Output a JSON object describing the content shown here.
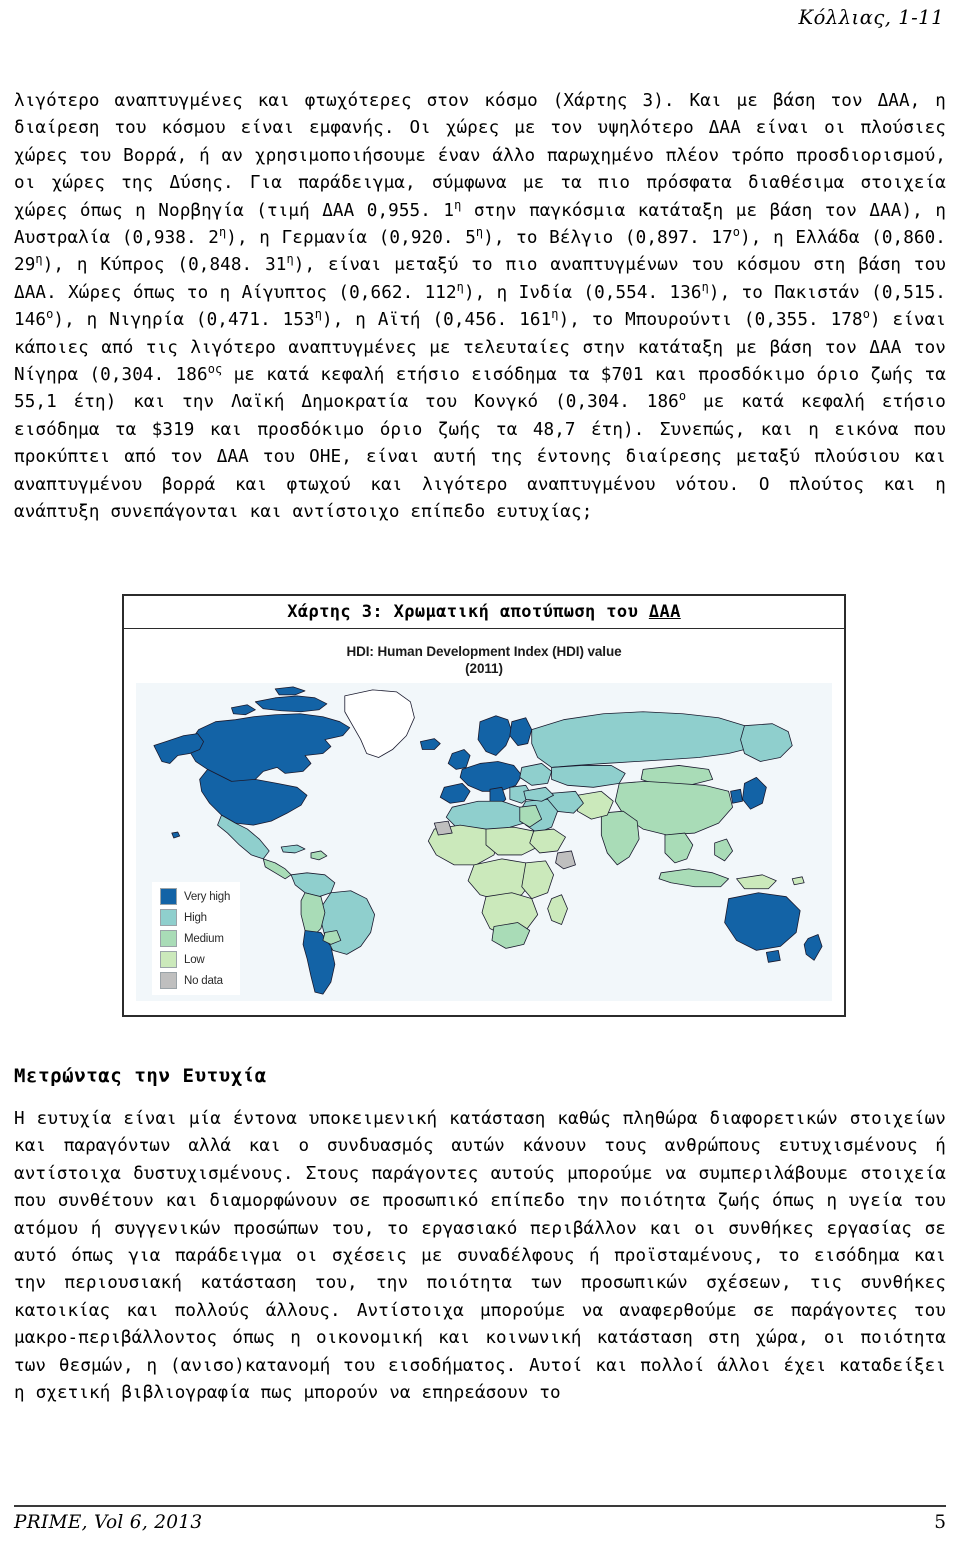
{
  "running_head": "Κόλλιας, 1-11",
  "body": {
    "paragraph_1_parts": {
      "a": "λιγότερο αναπτυγμένες και φτωχότερες στον κόσμο (Χάρτης 3). Και με βάση τον ΔΑΑ, η διαίρεση του κόσμου είναι εμφανής. Οι χώρες με τον υψηλότερο ΔΑΑ είναι οι πλούσιες χώρες του Βορρά, ή αν χρησιμοποιήσουμε έναν άλλο παρωχημένο πλέον τρόπο προσδιορισμού, οι χώρες της Δύσης. Για παράδειγμα, σύμφωνα με τα πιο πρόσφατα διαθέσιμα στοιχεία χώρες όπως η Νορβηγία (τιμή ΔΑΑ 0,955. 1",
      "sup1": "η",
      "b": " στην παγκόσμια κατάταξη με βάση τον ΔΑΑ), η Αυστραλία (0,938. 2",
      "sup2": "η",
      "c": "), η Γερμανία (0,920. 5",
      "sup3": "η",
      "d": "), το Βέλγιο (0,897. 17",
      "sup4": "ο",
      "e": "), η Ελλάδα (0,860. 29",
      "sup5": "η",
      "f": "), η Κύπρος (0,848. 31",
      "sup6": "η",
      "g": "), είναι μεταξύ το πιο αναπτυγμένων του κόσμου στη βάση του ΔΑΑ. Χώρες όπως το η Αίγυπτος (0,662. 112",
      "sup7": "η",
      "h": "), η Ινδία (0,554. 136",
      "sup8": "η",
      "i": "), το Πακιστάν (0,515. 146",
      "sup9": "ο",
      "j": "), η Νιγηρία (0,471. 153",
      "sup10": "η",
      "k": "), η Αϊτή (0,456. 161",
      "sup11": "η",
      "l": "), το Μπουρούντι (0,355. 178",
      "sup12": "ο",
      "m": ") είναι κάποιες από τις λιγότερο αναπτυγμένες με τελευταίες στην κατάταξη με βάση τον ΔΑΑ τον Νίγηρα (0,304. 186",
      "sup13": "ος",
      "n": " με κατά κεφαλή ετήσιο εισόδημα τα $701 και προσδόκιμο όριο ζωής τα 55,1 έτη) και την Λαϊκή Δημοκρατία του Κονγκό  (0,304. 186",
      "sup14": "ο",
      "o": " με κατά κεφαλή ετήσιο εισόδημα τα $319 και προσδόκιμο όριο ζωής τα 48,7 έτη).  Συνεπώς, και η εικόνα που προκύπτει από τον ΔΑΑ του ΟΗΕ, είναι αυτή της έντονης διαίρεσης μεταξύ πλούσιου και αναπτυγμένου βορρά και φτωχού και λιγότερο αναπτυγμένου νότου. Ο πλούτος και η ανάπτυξη συνεπάγονται και αντίστοιχο επίπεδο ευτυχίας;"
    }
  },
  "figure": {
    "caption_prefix": "Χάρτης 3: Χρωματική αποτύπωση του ",
    "caption_underlined": "ΔΑΑ",
    "map_title_line1": "HDI: Human Development Index (HDI) value",
    "map_title_line2": "(2011)",
    "legend": [
      {
        "label": "Very high",
        "color": "#1363a6"
      },
      {
        "label": "High",
        "color": "#8fcfcd"
      },
      {
        "label": "Medium",
        "color": "#a9dcb7"
      },
      {
        "label": "Low",
        "color": "#cbe9bb"
      },
      {
        "label": "No data",
        "color": "#bfbfbf"
      }
    ],
    "ocean_color": "#f2f7fa",
    "border_color": "#1a1a2e"
  },
  "section": {
    "heading": "Μετρώντας την Ευτυχία",
    "paragraph": "Η ευτυχία είναι μία έντονα υποκειμενική κατάσταση καθώς πληθώρα διαφορετικών στοιχείων και παραγόντων αλλά και ο συνδυασμός αυτών κάνουν τους ανθρώπους ευτυχισμένους ή αντίστοιχα δυστυχισμένους. Στους παράγοντες αυτούς μπορούμε να συμπεριλάβουμε στοιχεία που συνθέτουν και διαμορφώνουν σε προσωπικό επίπεδο την ποιότητα ζωής όπως η υγεία του ατόμου ή συγγενικών προσώπων του, το εργασιακό περιβάλλον και οι συνθήκες εργασίας σε αυτό όπως για παράδειγμα οι σχέσεις με συναδέλφους ή προϊσταμένους, το εισόδημα και την περιουσιακή κατάσταση του, την ποιότητα των προσωπικών σχέσεων, τις συνθήκες κατοικίας και πολλούς άλλους. Αντίστοιχα μπορούμε να αναφερθούμε σε παράγοντες του μακρο-περιβάλλοντος όπως η οικονομική και κοινωνική κατάσταση στη χώρα, οι ποιότητα των θεσμών, η (ανισο)κατανομή του εισοδήματος. Αυτοί και πολλοί άλλοι έχει καταδείξει η σχετική βιβλιογραφία πως μπορούν να επηρεάσουν το"
  },
  "footer": {
    "left": "PRIME, Vol 6, 2013",
    "page": "5"
  }
}
